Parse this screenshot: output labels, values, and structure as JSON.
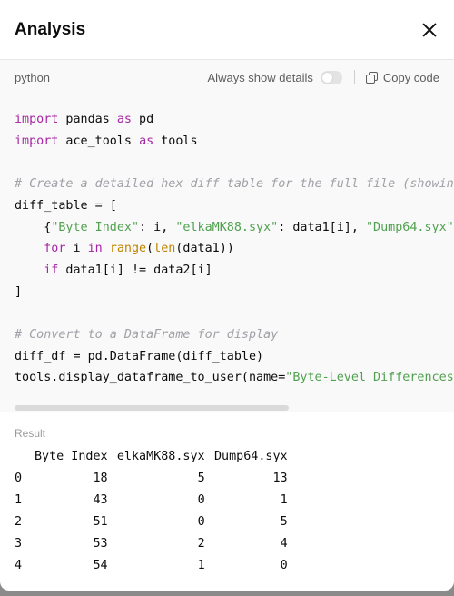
{
  "dialog": {
    "title": "Analysis"
  },
  "code_block": {
    "language": "python",
    "always_show_details_label": "Always show details",
    "always_show_details_on": false,
    "copy_label": "Copy code"
  },
  "result": {
    "label": "Result",
    "columns": [
      "",
      "Byte Index",
      "elkaMK88.syx",
      "Dump64.syx"
    ],
    "rows": [
      [
        "0",
        "18",
        "5",
        "13"
      ],
      [
        "1",
        "43",
        "0",
        "1"
      ],
      [
        "2",
        "51",
        "0",
        "5"
      ],
      [
        "3",
        "53",
        "2",
        "4"
      ],
      [
        "4",
        "54",
        "1",
        "0"
      ]
    ]
  },
  "colors": {
    "keyword": "#a626a4",
    "builtin": "#c18401",
    "string": "#50a14f",
    "comment": "#a0a1a7"
  }
}
